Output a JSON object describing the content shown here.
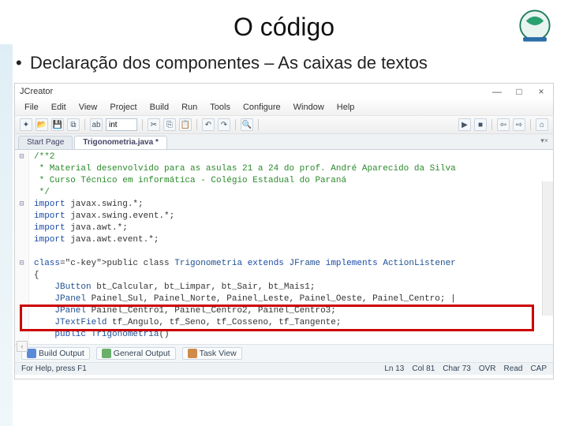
{
  "slide": {
    "title": "O código",
    "bullet": "Declaração dos componentes – As caixas de textos"
  },
  "ide": {
    "app_title": "JCreator",
    "window": {
      "min": "—",
      "max": "□",
      "close": "×"
    },
    "menu": [
      "File",
      "Edit",
      "View",
      "Project",
      "Build",
      "Run",
      "Tools",
      "Configure",
      "Window",
      "Help"
    ],
    "toolbar": {
      "input_value": "int",
      "icons": [
        "new",
        "open",
        "save",
        "saveall",
        "|",
        "cut",
        "copy",
        "paste",
        "|",
        "undo",
        "redo",
        "|",
        "find",
        "|",
        "run",
        "stop",
        "|",
        "back",
        "fwd",
        "|",
        "home"
      ]
    },
    "tabs": {
      "start": "Start Page",
      "active": "Trigonometria.java *",
      "close_hint": "▾×"
    },
    "code_lines": [
      {
        "g": "⊟",
        "cls": "c-comment",
        "t": "/**2"
      },
      {
        "g": "",
        "cls": "c-comment",
        "t": " * Material desenvolvido para as asulas 21 a 24 do prof. André Aparecido da Silva"
      },
      {
        "g": "",
        "cls": "c-comment",
        "t": " * Curso Técnico em informática - Colégio Estadual do Paraná"
      },
      {
        "g": "",
        "cls": "c-comment",
        "t": " */"
      },
      {
        "g": "⊟",
        "cls": "",
        "t": "import javax.swing.*;",
        "k": [
          "import"
        ]
      },
      {
        "g": "",
        "cls": "",
        "t": "import javax.swing.event.*;",
        "k": [
          "import"
        ]
      },
      {
        "g": "",
        "cls": "",
        "t": "import java.awt.*;",
        "k": [
          "import"
        ]
      },
      {
        "g": "",
        "cls": "",
        "t": "import java.awt.event.*;",
        "k": [
          "import"
        ]
      },
      {
        "g": "",
        "cls": "",
        "t": ""
      },
      {
        "g": "⊟",
        "cls": "",
        "t": "public class Trigonometria extends JFrame implements ActionListener",
        "k": [
          "public",
          "class",
          "extends",
          "implements"
        ]
      },
      {
        "g": "",
        "cls": "",
        "t": "{"
      },
      {
        "g": "",
        "cls": "",
        "t": "    JButton bt_Calcular, bt_Limpar, bt_Sair, bt_Mais1;",
        "k": [
          "JButton"
        ]
      },
      {
        "g": "",
        "cls": "",
        "t": "    JPanel Painel_Sul, Painel_Norte, Painel_Leste, Painel_Oeste, Painel_Centro; |",
        "k": [
          "JPanel"
        ]
      },
      {
        "g": "",
        "cls": "",
        "t": "    JPanel Painel_Centro1, Painel_Centro2, Painel_Centro3;",
        "k": [
          "JPanel"
        ]
      },
      {
        "g": "",
        "cls": "",
        "t": "    JTextField tf_Angulo, tf_Seno, tf_Cosseno, tf_Tangente;",
        "k": [
          "JTextField"
        ]
      },
      {
        "g": "",
        "cls": "",
        "t": "    public Trigonometria()",
        "k": [
          "public"
        ]
      }
    ],
    "corner_left": "‹",
    "bottom_tabs": [
      "Build Output",
      "General Output",
      "Task View"
    ],
    "status": {
      "left": "For Help, press F1",
      "cells": [
        "Ln 13",
        "Col 81",
        "Char 73",
        "OVR",
        "Read",
        "CAP"
      ]
    }
  }
}
